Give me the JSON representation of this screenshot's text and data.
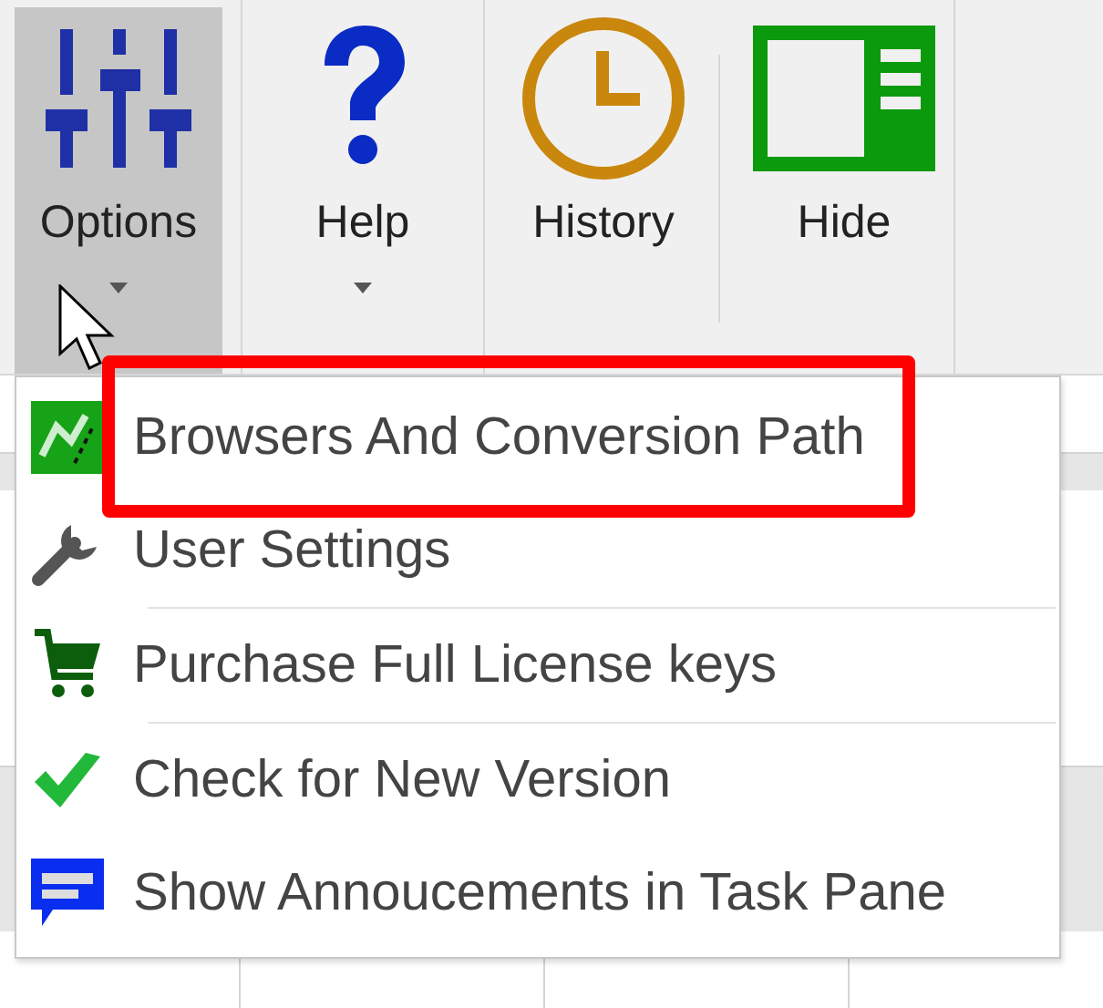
{
  "ribbon": {
    "buttons": [
      {
        "kind": "sliders",
        "label": "Options",
        "selected": true,
        "dropdown": true
      },
      {
        "kind": "help",
        "label": "Help",
        "selected": false,
        "dropdown": true
      },
      {
        "kind": "clock",
        "label": "History",
        "selected": false,
        "dropdown": false
      },
      {
        "kind": "panel",
        "label": "Hide",
        "selected": false,
        "dropdown": false
      }
    ]
  },
  "menu": {
    "items": [
      {
        "kind": "path",
        "label": "Browsers And Conversion Path",
        "divider_before": false
      },
      {
        "kind": "wrench",
        "label": "User Settings",
        "divider_before": false
      },
      {
        "kind": "cart",
        "label": "Purchase Full License keys",
        "divider_before": true
      },
      {
        "kind": "check",
        "label": "Check for New Version",
        "divider_before": true
      },
      {
        "kind": "message",
        "label": "Show Annoucements in Task Pane",
        "divider_before": false
      }
    ]
  }
}
